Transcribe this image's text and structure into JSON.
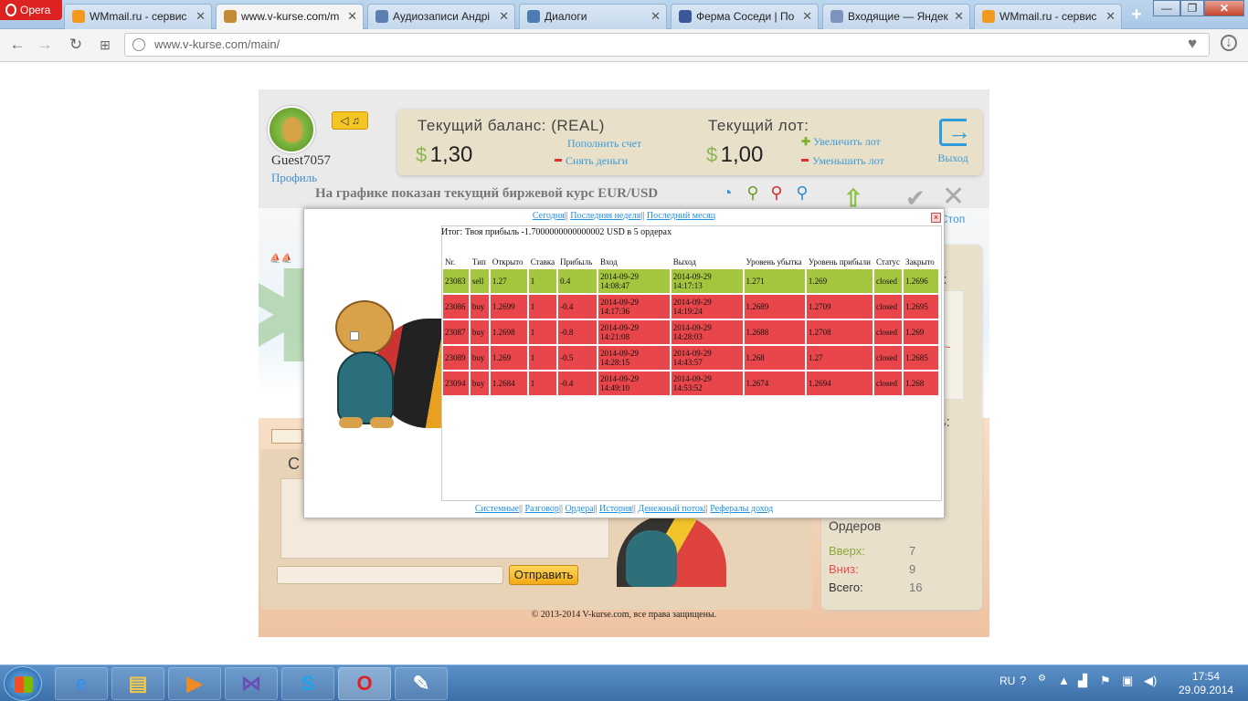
{
  "browser": {
    "app_name": "Opera",
    "tabs": [
      {
        "label": "WMmail.ru - сервис",
        "color": "#f39a1e"
      },
      {
        "label": "www.v-kurse.com/m",
        "color": "#c58b33",
        "active": true
      },
      {
        "label": "Аудиозаписи Андрі",
        "color": "#5a7fb0"
      },
      {
        "label": "Диалоги",
        "color": "#4f7bb5"
      },
      {
        "label": "Ферма Соседи | По",
        "color": "#3b5998"
      },
      {
        "label": "Входящие — Яндек",
        "color": "#7d93bb"
      },
      {
        "label": "WMmail.ru - сервис",
        "color": "#f39a1e"
      }
    ],
    "close_glyph": "✕",
    "new_tab": "+",
    "url": "www.v-kurse.com/main/",
    "window_buttons": [
      "—",
      "❐",
      "✕"
    ]
  },
  "site": {
    "username": "Guest7057",
    "profile_label": "Профиль",
    "balance": {
      "label": "Текущий баланс: (REAL)",
      "currency": "$",
      "value": "1,30",
      "deposit": "Пополнить счет",
      "withdraw": "Снять деньги"
    },
    "lot": {
      "label": "Текущий лот:",
      "currency": "$",
      "value": "1,00",
      "increase": "Увеличить лот",
      "decrease": "Уменьшить лот"
    },
    "exit_label": "Выход",
    "graph_title": "На графике показан текущий биржевой курс EUR/USD",
    "stop_label": "Стоп",
    "send_label": "Отправить",
    "chat_letter": "С",
    "side_glimpses": {
      "k": "к",
      "profit": "ль:",
      "tilde": "~"
    },
    "orders_stats": {
      "title": "Ордеров",
      "up_label": "Вверх:",
      "up_value": "7",
      "down_label": "Вниз:",
      "down_value": "9",
      "total_label": "Всего:",
      "total_value": "16"
    },
    "footer": "© 2013-2014 V-kurse.com, все права защищены.",
    "colors": {
      "up": "#8aa83a",
      "down": "#e05050",
      "link": "#3a9ad6"
    }
  },
  "modal": {
    "top_links": [
      "Сегодня",
      "Последняя неделя",
      "Последний месяц"
    ],
    "summary": "Итог: Твоя прибыль -1.7000000000000002 USD в 5 ордерах",
    "columns": [
      "Nr.",
      "Тип",
      "Открыто",
      "Ставка",
      "Прибыль",
      "Вход",
      "Выход",
      "Уровень убытка",
      "Уровень прибыли",
      "Статус",
      "Закрыто"
    ],
    "rows": [
      {
        "nr": "23083",
        "type": "sell",
        "open": "1.27",
        "stake": "1",
        "profit": "0.4",
        "in": "2014-09-29 14:08:47",
        "out": "2014-09-29 14:17:13",
        "sl": "1.271",
        "tp": "1.269",
        "status": "closed",
        "closed": "1.2696",
        "color": "#a4c63f"
      },
      {
        "nr": "23086",
        "type": "buy",
        "open": "1.2699",
        "stake": "1",
        "profit": "-0.4",
        "in": "2014-09-29 14:17:36",
        "out": "2014-09-29 14:19:24",
        "sl": "1.2689",
        "tp": "1.2709",
        "status": "closed",
        "closed": "1.2695",
        "color": "#e8464a"
      },
      {
        "nr": "23087",
        "type": "buy",
        "open": "1.2698",
        "stake": "1",
        "profit": "-0.8",
        "in": "2014-09-29 14:21:08",
        "out": "2014-09-29 14:28:03",
        "sl": "1.2688",
        "tp": "1.2708",
        "status": "closed",
        "closed": "1.269",
        "color": "#e8464a"
      },
      {
        "nr": "23089",
        "type": "buy",
        "open": "1.269",
        "stake": "1",
        "profit": "-0.5",
        "in": "2014-09-29 14:28:15",
        "out": "2014-09-29 14:43:57",
        "sl": "1.268",
        "tp": "1.27",
        "status": "closed",
        "closed": "1.2685",
        "color": "#e8464a"
      },
      {
        "nr": "23094",
        "type": "buy",
        "open": "1.2684",
        "stake": "1",
        "profit": "-0.4",
        "in": "2014-09-29 14:49:10",
        "out": "2014-09-29 14:53:52",
        "sl": "1.2674",
        "tp": "1.2694",
        "status": "closed",
        "closed": "1.268",
        "color": "#e8464a"
      }
    ],
    "bottom_links": [
      "Системные",
      "Разговор",
      "Ордера",
      "История",
      "Денежный поток",
      "Рефералы доход"
    ]
  },
  "taskbar": {
    "buttons": [
      {
        "name": "ie",
        "glyph": "e",
        "color": "#3a8ee6"
      },
      {
        "name": "explorer",
        "glyph": "▤",
        "color": "#f3c94b"
      },
      {
        "name": "media-player",
        "glyph": "▶",
        "color": "#f08a24"
      },
      {
        "name": "switcher",
        "glyph": "⋈",
        "color": "#6a4fb5"
      },
      {
        "name": "skype",
        "glyph": "S",
        "color": "#1aa5e8"
      },
      {
        "name": "opera",
        "glyph": "O",
        "color": "#e02020"
      },
      {
        "name": "paint",
        "glyph": "✎",
        "color": "#ffffff"
      }
    ],
    "lang": "RU",
    "time": "17:54",
    "date": "29.09.2014"
  }
}
